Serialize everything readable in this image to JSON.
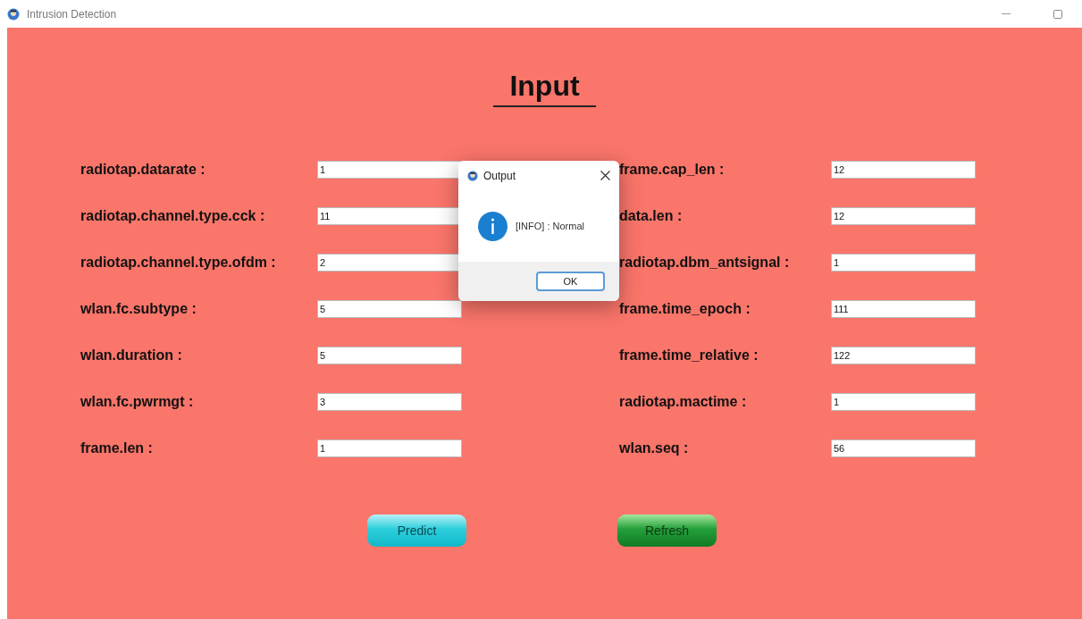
{
  "window": {
    "title": "Intrusion Detection"
  },
  "heading": "Input",
  "left_fields": [
    {
      "label": "radiotap.datarate :",
      "value": "1"
    },
    {
      "label": "radiotap.channel.type.cck :",
      "value": "11"
    },
    {
      "label": "radiotap.channel.type.ofdm :",
      "value": "2"
    },
    {
      "label": "wlan.fc.subtype :",
      "value": "5"
    },
    {
      "label": "wlan.duration :",
      "value": "5"
    },
    {
      "label": "wlan.fc.pwrmgt :",
      "value": "3"
    },
    {
      "label": "frame.len :",
      "value": "1"
    }
  ],
  "right_fields": [
    {
      "label": "frame.cap_len :",
      "value": "12"
    },
    {
      "label": "data.len :",
      "value": "12"
    },
    {
      "label": "radiotap.dbm_antsignal :",
      "value": "1"
    },
    {
      "label": "frame.time_epoch :",
      "value": "111"
    },
    {
      "label": "frame.time_relative :",
      "value": "122"
    },
    {
      "label": "radiotap.mactime :",
      "value": "1"
    },
    {
      "label": "wlan.seq :",
      "value": "56"
    }
  ],
  "buttons": [
    {
      "label": "Predict",
      "kind": "cyan"
    },
    {
      "label": "Refresh",
      "kind": "green"
    }
  ],
  "dialog": {
    "title": "Output",
    "message": "[INFO] : Normal",
    "button": "OK"
  }
}
